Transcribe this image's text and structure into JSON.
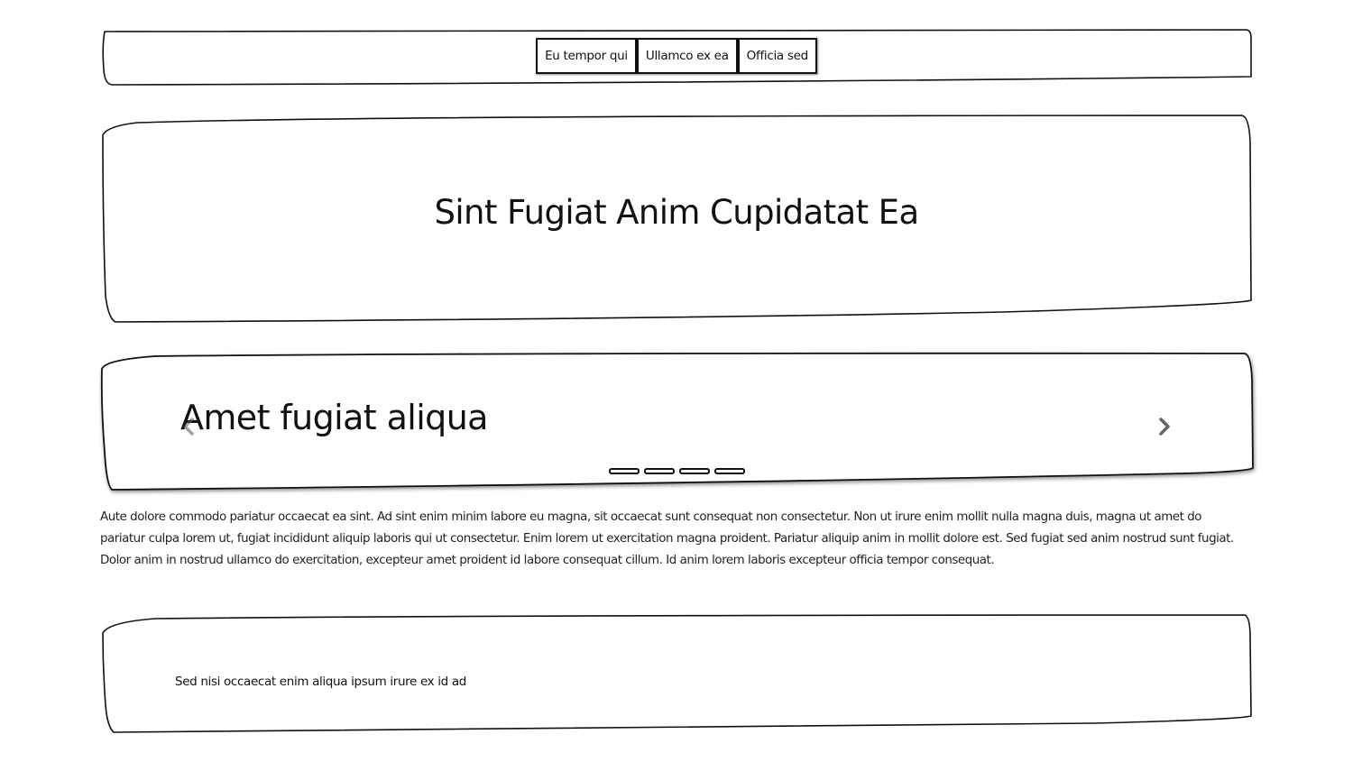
{
  "nav": {
    "buttons": [
      {
        "label": "Eu tempor qui"
      },
      {
        "label": "Ullamco ex ea"
      },
      {
        "label": "Officia sed"
      }
    ]
  },
  "hero": {
    "title": "Sint Fugiat Anim Cupidatat Ea"
  },
  "carousel": {
    "slide_title": "Amet fugiat aliqua",
    "prev_icon": "chevron-left-icon",
    "next_icon": "chevron-right-icon",
    "indicator_count": 4,
    "active_index": 0
  },
  "paragraph": {
    "text": "Aute dolore commodo pariatur occaecat ea sint. Ad sint enim minim labore eu magna, sit occaecat sunt consequat non consectetur. Non ut irure enim mollit nulla magna duis, magna ut amet do pariatur culpa lorem ut, fugiat incididunt aliquip laboris qui ut consectetur. Enim lorem ut exercitation magna proident. Pariatur aliquip anim in mollit dolore est. Sed fugiat sed anim nostrud sunt fugiat. Dolor anim in nostrud ullamco do exercitation, excepteur amet proident id labore consequat cillum. Id anim lorem laboris excepteur officia tempor consequat."
  },
  "footer": {
    "text": "Sed nisi occaecat enim aliqua ipsum irure ex id ad"
  }
}
